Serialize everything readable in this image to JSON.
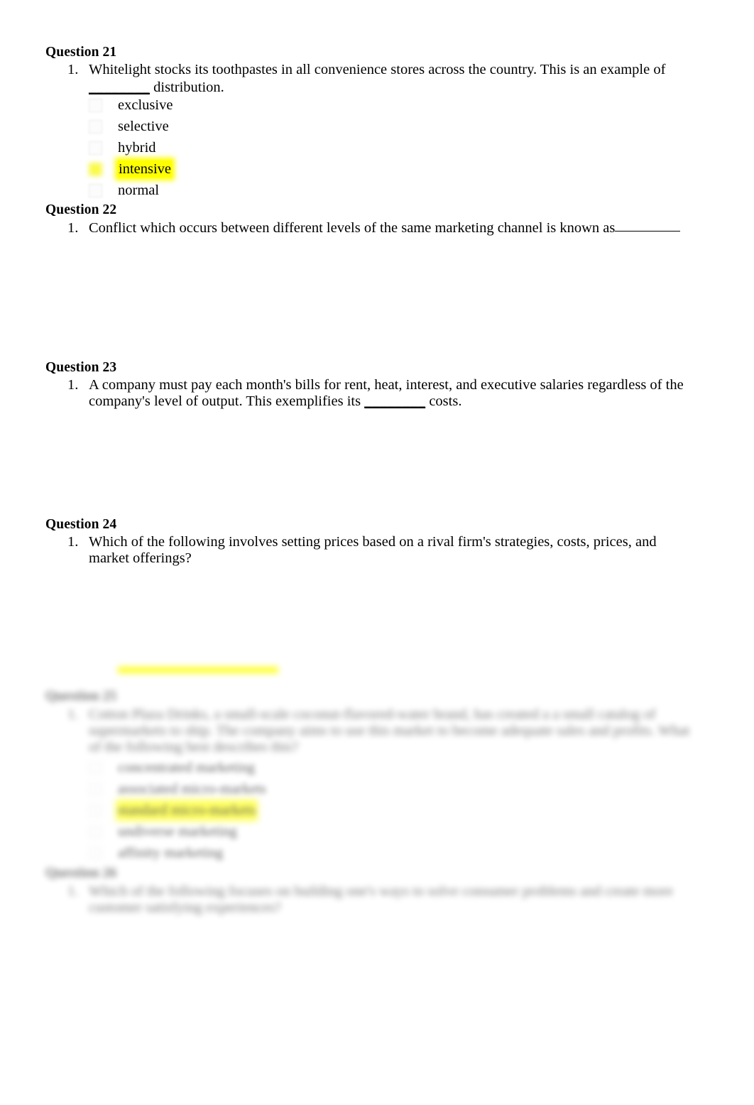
{
  "document": {
    "page_background": "#ffffff",
    "highlight_color": "#ffff00",
    "text_color": "#000000"
  },
  "questions": [
    {
      "heading": "Question 21",
      "number_marker": "1.",
      "prompt_line_1": "Whitelight stocks its toothpastes in all convenience stores across the country. This is an example of",
      "prompt_line_2_blank": "________",
      "prompt_line_2_rest": "distribution.",
      "options": [
        {
          "label": "exclusive",
          "selected": false
        },
        {
          "label": "selective",
          "selected": false
        },
        {
          "label": "hybrid",
          "selected": false
        },
        {
          "label": "intensive",
          "selected": true
        },
        {
          "label": "normal",
          "selected": false
        }
      ]
    },
    {
      "heading": "Question 22",
      "number_marker": "1.",
      "prompt_line_1": "Conflict which occurs between different levels of the same marketing channel is known as",
      "trailing_blank": true,
      "options": []
    },
    {
      "heading": "Question 23",
      "number_marker": "1.",
      "prompt_line_1": "A company must pay each month's bills for rent, heat, interest, and executive salaries regardless of the",
      "prompt_line_2_a": "company's level of output. This exemplifies its",
      "prompt_line_2_blank": "________",
      "prompt_line_2_b": "costs.",
      "options": []
    },
    {
      "heading": "Question 24",
      "number_marker": "1.",
      "prompt_line_1": "Which of the following involves setting prices based on a rival firm's strategies, costs, prices, and",
      "prompt_line_2": "market offerings?",
      "options": []
    }
  ],
  "blurred_sections": [
    {
      "heading": "Question 25",
      "legible": false,
      "number_marker": "1.",
      "prompt_line_1": "Cotton Plaza Drinks, a small-scale coconut-flavored-water brand, has created a a small catalog of",
      "prompt_line_2": "supermarkets to ship. The company aims to use this market to become adequate sales and profits. What",
      "prompt_line_3": "of the following best describes this?",
      "options": [
        {
          "label": "concentrated marketing",
          "selected": false
        },
        {
          "label": "associated micro-markets",
          "selected": false
        },
        {
          "label": "standard micro-markets",
          "selected": true
        },
        {
          "label": "undiverse marketing",
          "selected": false
        },
        {
          "label": "affinity marketing",
          "selected": false
        }
      ]
    },
    {
      "heading": "Question 26",
      "legible": false,
      "number_marker": "1.",
      "prompt_line_1": "Which of the following focuses on building one's ways to solve consumer problems and create more",
      "prompt_line_2": "customer satisfying experiences?"
    }
  ],
  "floating_highlight_bar": {
    "note": "partially cropped highlighted line",
    "color": "#ffff00"
  }
}
